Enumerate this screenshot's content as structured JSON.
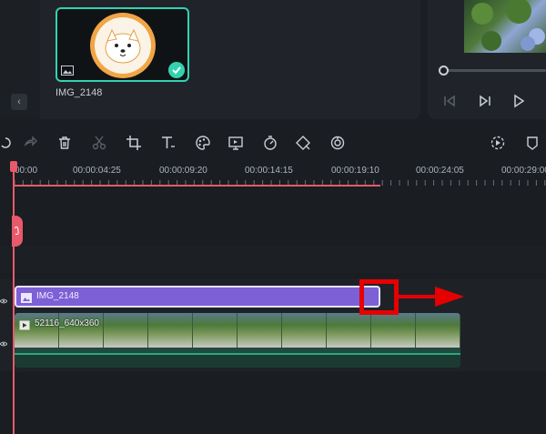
{
  "media": {
    "clip_name": "IMG_2148",
    "collapse_icon": "chevron-left-icon"
  },
  "toolbar": {
    "tools": [
      "undo-icon",
      "redo-icon",
      "delete-icon",
      "cut-icon",
      "crop-icon",
      "text-icon",
      "color-icon",
      "display-icon",
      "speed-icon",
      "keyframe-icon",
      "stabilize-icon",
      "render-icon",
      "marker-icon"
    ]
  },
  "ruler": {
    "ticks": [
      "00:00",
      "00:00:04:25",
      "00:00:09:20",
      "00:00:14:15",
      "00:00:19:10",
      "00:00:24:05",
      "00:00:29:00"
    ]
  },
  "timeline": {
    "image_clip_label": "IMG_2148",
    "video_clip_label": "52116_640x360"
  },
  "colors": {
    "accent": "#34d1b0",
    "playhead": "#e8596a",
    "image_clip": "#7d5fd6",
    "annotation": "#e60000"
  }
}
